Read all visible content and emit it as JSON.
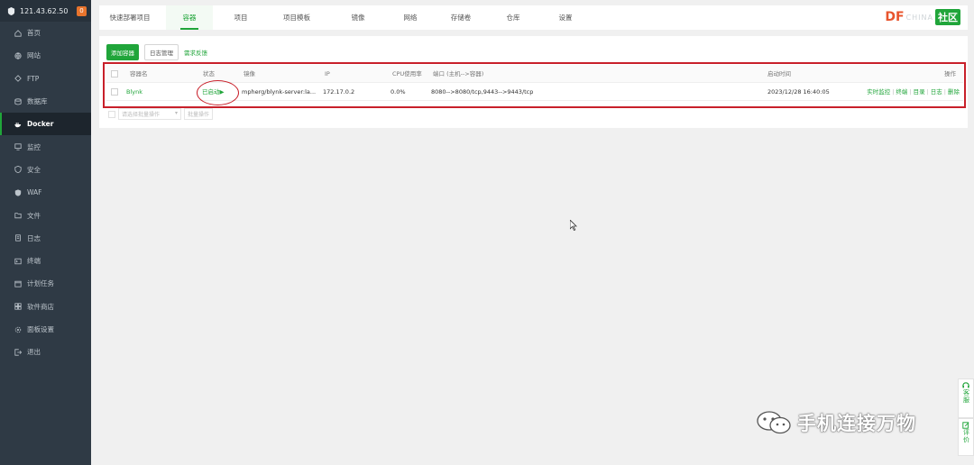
{
  "server": {
    "ip": "121.43.62.50",
    "badge": "0"
  },
  "sidebar": {
    "items": [
      {
        "label": "首页",
        "icon": "home-icon"
      },
      {
        "label": "网站",
        "icon": "globe-icon"
      },
      {
        "label": "FTP",
        "icon": "ftp-icon"
      },
      {
        "label": "数据库",
        "icon": "database-icon"
      },
      {
        "label": "Docker",
        "icon": "docker-icon",
        "active": true
      },
      {
        "label": "监控",
        "icon": "monitor-icon"
      },
      {
        "label": "安全",
        "icon": "shield-icon"
      },
      {
        "label": "WAF",
        "icon": "waf-icon"
      },
      {
        "label": "文件",
        "icon": "folder-icon"
      },
      {
        "label": "日志",
        "icon": "log-icon"
      },
      {
        "label": "终端",
        "icon": "terminal-icon"
      },
      {
        "label": "计划任务",
        "icon": "schedule-icon"
      },
      {
        "label": "软件商店",
        "icon": "store-icon"
      },
      {
        "label": "面板设置",
        "icon": "settings-icon"
      },
      {
        "label": "退出",
        "icon": "logout-icon"
      }
    ]
  },
  "tabs": [
    {
      "label": "快速部署项目"
    },
    {
      "label": "容器",
      "active": true
    },
    {
      "label": "项目"
    },
    {
      "label": "项目模板"
    },
    {
      "label": "镜像"
    },
    {
      "label": "网络"
    },
    {
      "label": "存储卷"
    },
    {
      "label": "仓库"
    },
    {
      "label": "设置"
    }
  ],
  "logo": {
    "mark": "DF",
    "faded": "CHINA",
    "green": "社区"
  },
  "toolbar": {
    "add_container": "添加容器",
    "log_manage": "日志管理",
    "feedback": "需求反馈"
  },
  "table": {
    "headers": {
      "name": "容器名",
      "status": "状态",
      "image": "镜像",
      "ip": "IP",
      "cpu": "CPU使用率",
      "ports": "端口 (主机-->容器)",
      "started": "启动时间",
      "ops": "操作"
    },
    "rows": [
      {
        "name": "Blynk",
        "status": "已启动",
        "image": "mpherg/blynk-server:la...",
        "ip": "172.17.0.2",
        "cpu": "0.0%",
        "ports": "8080-->8080/tcp,9443-->9443/tcp",
        "started": "2023/12/28 16:40:05",
        "ops": [
          "实时监控",
          "终端",
          "目录",
          "日志",
          "删除"
        ]
      }
    ]
  },
  "batch": {
    "select": "请选择批量操作",
    "button": "批量操作"
  },
  "float": {
    "service": "客服",
    "review": "评价"
  },
  "watermark": {
    "text": "手机连接万物"
  },
  "colors": {
    "accent": "#20a53a",
    "highlight": "#c8202a",
    "sidebar": "#2f3a45"
  }
}
